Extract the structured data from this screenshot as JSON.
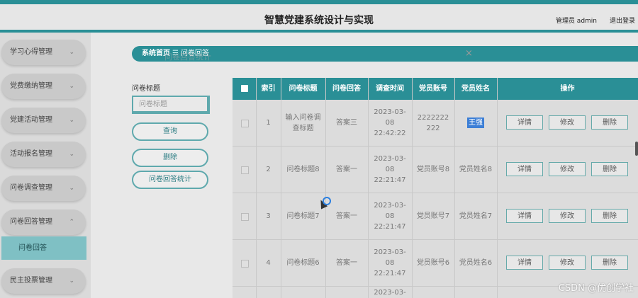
{
  "header": {
    "title": "智慧党建系统设计与实现",
    "admin": "管理员 admin",
    "logout": "退出登录"
  },
  "sidebar": {
    "items": [
      {
        "label": "学习心得管理",
        "chevron": "⌄"
      },
      {
        "label": "党费缴纳管理",
        "chevron": "⌄"
      },
      {
        "label": "党建活动管理",
        "chevron": "⌄"
      },
      {
        "label": "活动报名管理",
        "chevron": "⌄"
      },
      {
        "label": "问卷调查管理",
        "chevron": "⌄"
      },
      {
        "label": "问卷回答管理",
        "chevron": "⌃"
      },
      {
        "label": "民主投票管理",
        "chevron": "⌄"
      }
    ],
    "submenu": {
      "label": "问卷回答"
    }
  },
  "breadcrumb": {
    "home": "系统首页",
    "sep": "☰",
    "current": "问卷回答",
    "ghost": "问卷回答统计",
    "close": "×"
  },
  "search": {
    "label": "问卷标题",
    "placeholder": "问卷标题",
    "query_btn": "查询",
    "delete_btn": "删除",
    "stats_btn": "问卷回答统计"
  },
  "table": {
    "headers": {
      "index": "索引",
      "title": "问卷标题",
      "answer": "问卷回答",
      "time": "调查时间",
      "account": "党员账号",
      "name": "党员姓名",
      "ops": "操作"
    },
    "rows": [
      {
        "index": "1",
        "title": "输入问卷调查标题",
        "answer": "答案三",
        "time": "2023-03-08 22:42:22",
        "account": "2222222222",
        "name": "王强"
      },
      {
        "index": "2",
        "title": "问卷标题8",
        "answer": "答案一",
        "time": "2023-03-08 22:21:47",
        "account": "党员账号8",
        "name": "党员姓名8"
      },
      {
        "index": "3",
        "title": "问卷标题7",
        "answer": "答案一",
        "time": "2023-03-08 22:21:47",
        "account": "党员账号7",
        "name": "党员姓名7"
      },
      {
        "index": "4",
        "title": "问卷标题6",
        "answer": "答案一",
        "time": "2023-03-08 22:21:47",
        "account": "党员账号6",
        "name": "党员姓名6"
      },
      {
        "index": "",
        "title": "",
        "answer": "",
        "time": "2023-03-",
        "account": "",
        "name": ""
      }
    ],
    "ops": {
      "detail": "详情",
      "edit": "修改",
      "delete": "删除"
    }
  },
  "watermark": "CSDN @优创学社",
  "colors": {
    "accent": "#2a8f96",
    "selection": "#3d7fd6"
  }
}
